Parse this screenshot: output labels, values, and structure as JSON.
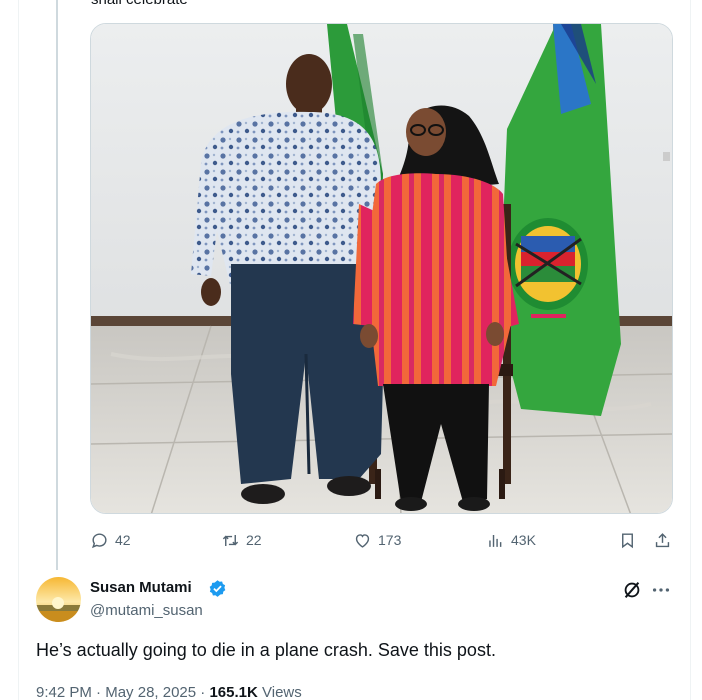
{
  "quoted_tweet": {
    "text_snippet": "shall celebrate",
    "metrics": {
      "replies": "42",
      "retweets": "22",
      "likes": "173",
      "views": "43K"
    }
  },
  "reply": {
    "author_name": "Susan Mutami",
    "handle": "@mutami_susan",
    "text": "He’s actually going to die in a plane crash. Save this post.",
    "time": "9:42 PM",
    "separator": " · ",
    "date": "May 28, 2025",
    "views_count": "165.1K",
    "views_label": " Views"
  },
  "icons": {
    "reply": "reply-icon",
    "retweet": "retweet-icon",
    "like": "heart-icon",
    "views": "analytics-icon",
    "bookmark": "bookmark-icon",
    "share": "share-icon",
    "verified": "verified-badge-icon",
    "grok": "grok-icon",
    "more": "more-icon"
  },
  "colors": {
    "verified_blue": "#1d9bf0",
    "secondary_text": "#536471",
    "primary_text": "#0f1419"
  }
}
